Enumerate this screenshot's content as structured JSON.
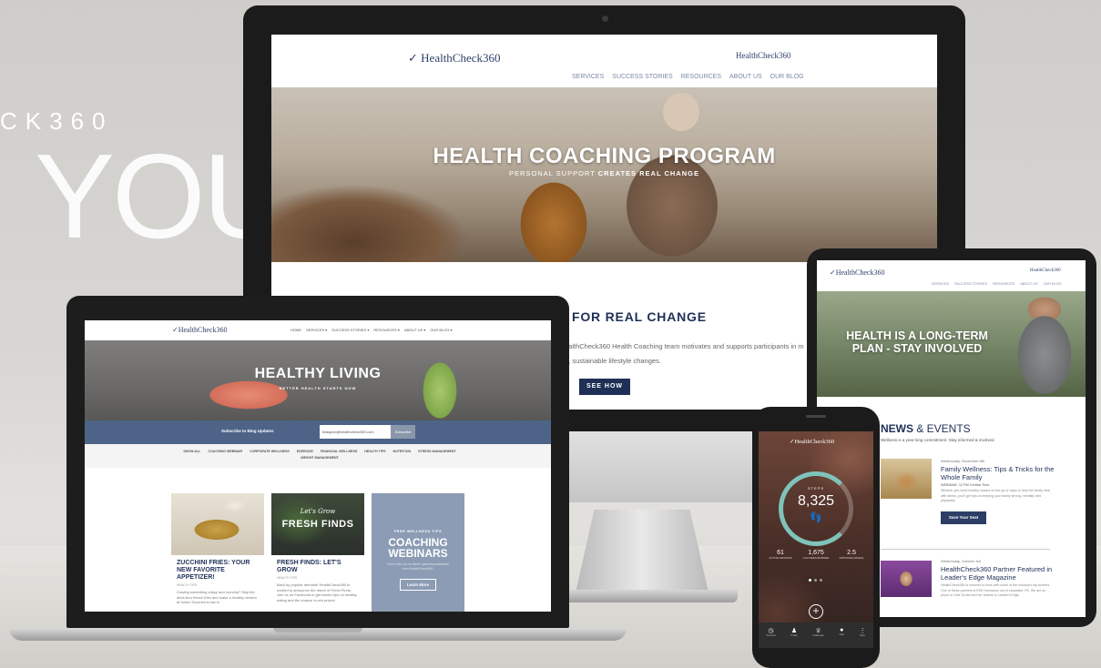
{
  "background": {
    "brand_partial": "CK360",
    "big_word": "YOU"
  },
  "imac": {
    "logo": "HealthCheck360",
    "partner_logo": "HealthCheck360",
    "nav": [
      "SERVICES",
      "SUCCESS STORIES",
      "RESOURCES",
      "ABOUT US",
      "OUR BLOG"
    ],
    "hero_title": "HEALTH COACHING PROGRAM",
    "hero_sub_light": "PERSONAL SUPPORT",
    "hero_sub_bold": "CREATES REAL CHANGE",
    "section_title": "FOR REAL CHANGE",
    "body_line1": "ealthCheck360 Health Coaching team motivates and supports participants in m",
    "body_line2": "n, sustainable lifestyle changes.",
    "cta": "SEE HOW"
  },
  "laptop": {
    "logo": "HealthCheck360",
    "nav": [
      "HOME",
      "SERVICES ▾",
      "SUCCESS STORIES ▾",
      "RESOURCES ▾",
      "ABOUT US ▾",
      "OUR BLOG ▾"
    ],
    "hero_title": "HEALTHY LIVING",
    "hero_sub": "BETTER HEALTH STARTS NOW",
    "subscribe_label": "Subscribe to Blog Updates",
    "subscribe_value": "bilasjean@healthcheck360.com",
    "subscribe_button": "Subscribe",
    "filters": [
      "SHOW ALL",
      "COACHING WEBINAR",
      "CORPORATE WELLNESS",
      "EXERCISE",
      "FINANCIAL WELLNESS",
      "HEALTH TIPS",
      "NUTRITION",
      "STRESS MANAGEMENT",
      "WEIGHT MANAGEMENT"
    ],
    "cards": [
      {
        "title": "ZUCCHINI FRIES: YOUR NEW FAVORITE APPETIZER!",
        "tag": "HEALTH TIPS",
        "text": "Craving something crispy and crunchy? Skip the drive-thru french fries and make a healthy version at home! Zucchini is low in"
      },
      {
        "title": "FRESH FINDS: LET'S GROW",
        "tag": "HEALTH TIPS",
        "text": "Back by popular demand! HealthCheck360 is excited to announce the return of Fresh Finds. Join us on Facebook to get insider tips on healthy eating and the chance to win prizes!",
        "image_script": "Let's Grow",
        "image_title": "FRESH FINDS"
      },
      {
        "kicker": "FREE WELLNESS TIPS",
        "title": "COACHING WEBINARS",
        "text": "Don't miss out on these upcoming webinars from HealthCheck360.",
        "button": "Learn More"
      }
    ]
  },
  "tablet": {
    "logo": "HealthCheck360",
    "partner_logo": "HealthCheck360",
    "nav": [
      "SERVICES",
      "SUCCESS STORIES",
      "RESOURCES",
      "ABOUT US",
      "OUR BLOG"
    ],
    "hero_title": "HEALTH IS A LONG-TERM PLAN - STAY INVOLVED",
    "section_bold": "NEWS",
    "section_rest": " & EVENTS",
    "section_sub": "Wellness is a year-long commitment. Stay informed & involved.",
    "events": [
      {
        "date": "Wednesday, November 8th",
        "title": "Family Wellness: Tips & Tricks for the Whole Family",
        "meta": "WEBINAR: 12 PM Central Time",
        "text": "Whether you need healthy snacks on-the-go or ways to help the family deal with stress, you'll get tips on keeping your family strong, mentally and physically.",
        "button": "Save Your Seat"
      },
      {
        "date": "Wednesday, October 3rd",
        "title": "HealthCheck360 Partner Featured in Leader's Edge Magazine",
        "text": "HealthCheck360 is honored to work with some of the industry's top brokers. One of these partners is EHD Insurance out of Lancaster, PA. We are so proud of Julie Grube and her feature in Leader's Edge"
      }
    ]
  },
  "phone": {
    "logo": "HealthCheck360",
    "steps_label": "STEPS",
    "steps_value": "8,325",
    "steps_progress": 0.75,
    "stats": [
      {
        "value": "61",
        "label": "ACTIVE MINUTES"
      },
      {
        "value": "1,675",
        "label": "CALORIES BURNED"
      },
      {
        "value": "2.5",
        "label": "DISTANCE (MILES)"
      }
    ],
    "tabs": [
      "Overview",
      "Profile",
      "Challenges",
      "Chat",
      "More"
    ]
  },
  "colors": {
    "navy": "#1f3057",
    "slate_blue": "#4d6488",
    "teal": "#7fc3bb",
    "logo_blue": "#2c3e66"
  }
}
